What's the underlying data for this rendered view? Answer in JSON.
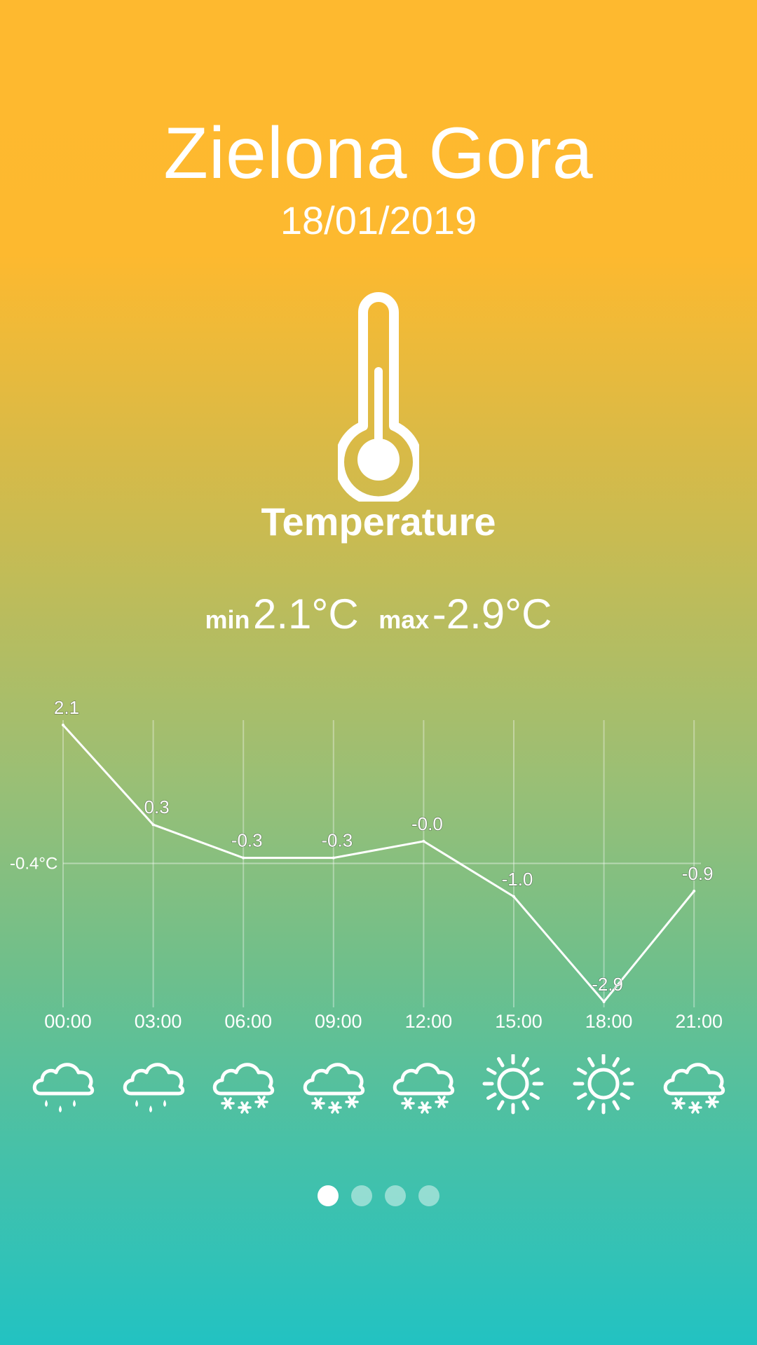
{
  "location": {
    "city": "Zielona Gora",
    "date": "18/01/2019"
  },
  "metric": {
    "icon": "thermometer-icon",
    "label": "Temperature"
  },
  "summary": {
    "min_label": "min",
    "min_value": "2.1°C",
    "max_label": "max",
    "max_value": "-2.9°C"
  },
  "chart_data": {
    "type": "line",
    "categories": [
      "00:00",
      "03:00",
      "06:00",
      "09:00",
      "12:00",
      "15:00",
      "18:00",
      "21:00"
    ],
    "values": [
      2.1,
      0.3,
      -0.3,
      -0.3,
      -0.0,
      -1.0,
      -2.9,
      -0.9
    ],
    "value_labels": [
      "2.1",
      "0.3",
      "-0.3",
      "-0.3",
      "-0.0",
      "-1.0",
      "-2.9",
      "-0.9"
    ],
    "reference_line": {
      "value": -0.4,
      "label": "-0.4°C"
    },
    "grid": true,
    "ylim": [
      -2.9,
      2.1
    ]
  },
  "forecast_icons": [
    "rain-icon",
    "rain-icon",
    "snow-icon",
    "snow-icon",
    "snow-icon",
    "sun-icon",
    "sun-icon",
    "snow-icon"
  ],
  "pager": {
    "count": 4,
    "active": 0
  },
  "colors": {
    "gradient_top": "#FEB92F",
    "gradient_bottom": "#22C2C2",
    "foreground": "#FFFFFF"
  }
}
